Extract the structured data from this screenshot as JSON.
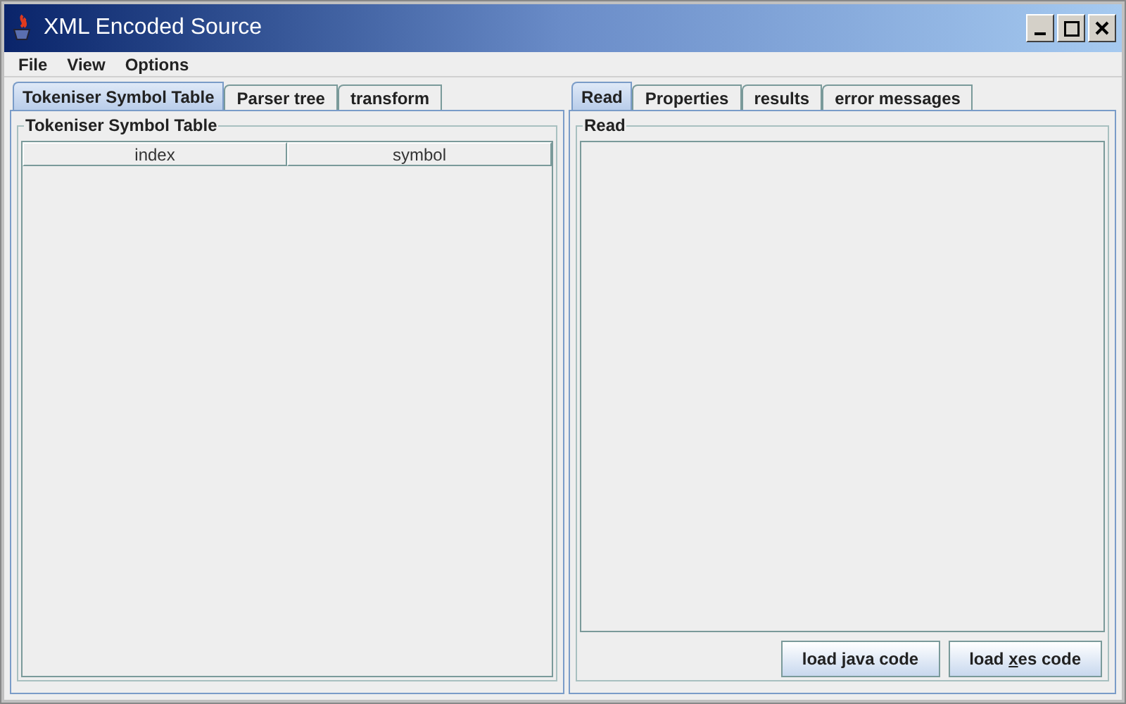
{
  "window": {
    "title": "XML Encoded Source"
  },
  "menu": [
    "File",
    "View",
    "Options"
  ],
  "left_pane": {
    "tabs": [
      {
        "label": "Tokeniser Symbol Table",
        "selected": true
      },
      {
        "label": "Parser tree",
        "selected": false
      },
      {
        "label": "transform",
        "selected": false
      }
    ],
    "group_title": "Tokeniser Symbol Table",
    "table": {
      "columns": [
        "index",
        "symbol"
      ]
    }
  },
  "right_pane": {
    "tabs": [
      {
        "label": "Read",
        "selected": true
      },
      {
        "label": "Properties",
        "selected": false
      },
      {
        "label": "results",
        "selected": false
      },
      {
        "label": "error messages",
        "selected": false
      }
    ],
    "group_title": "Read",
    "buttons": [
      {
        "before": "load ",
        "mnemonic": "j",
        "after": "ava code"
      },
      {
        "before": "load ",
        "mnemonic": "x",
        "after": "es code"
      }
    ]
  }
}
